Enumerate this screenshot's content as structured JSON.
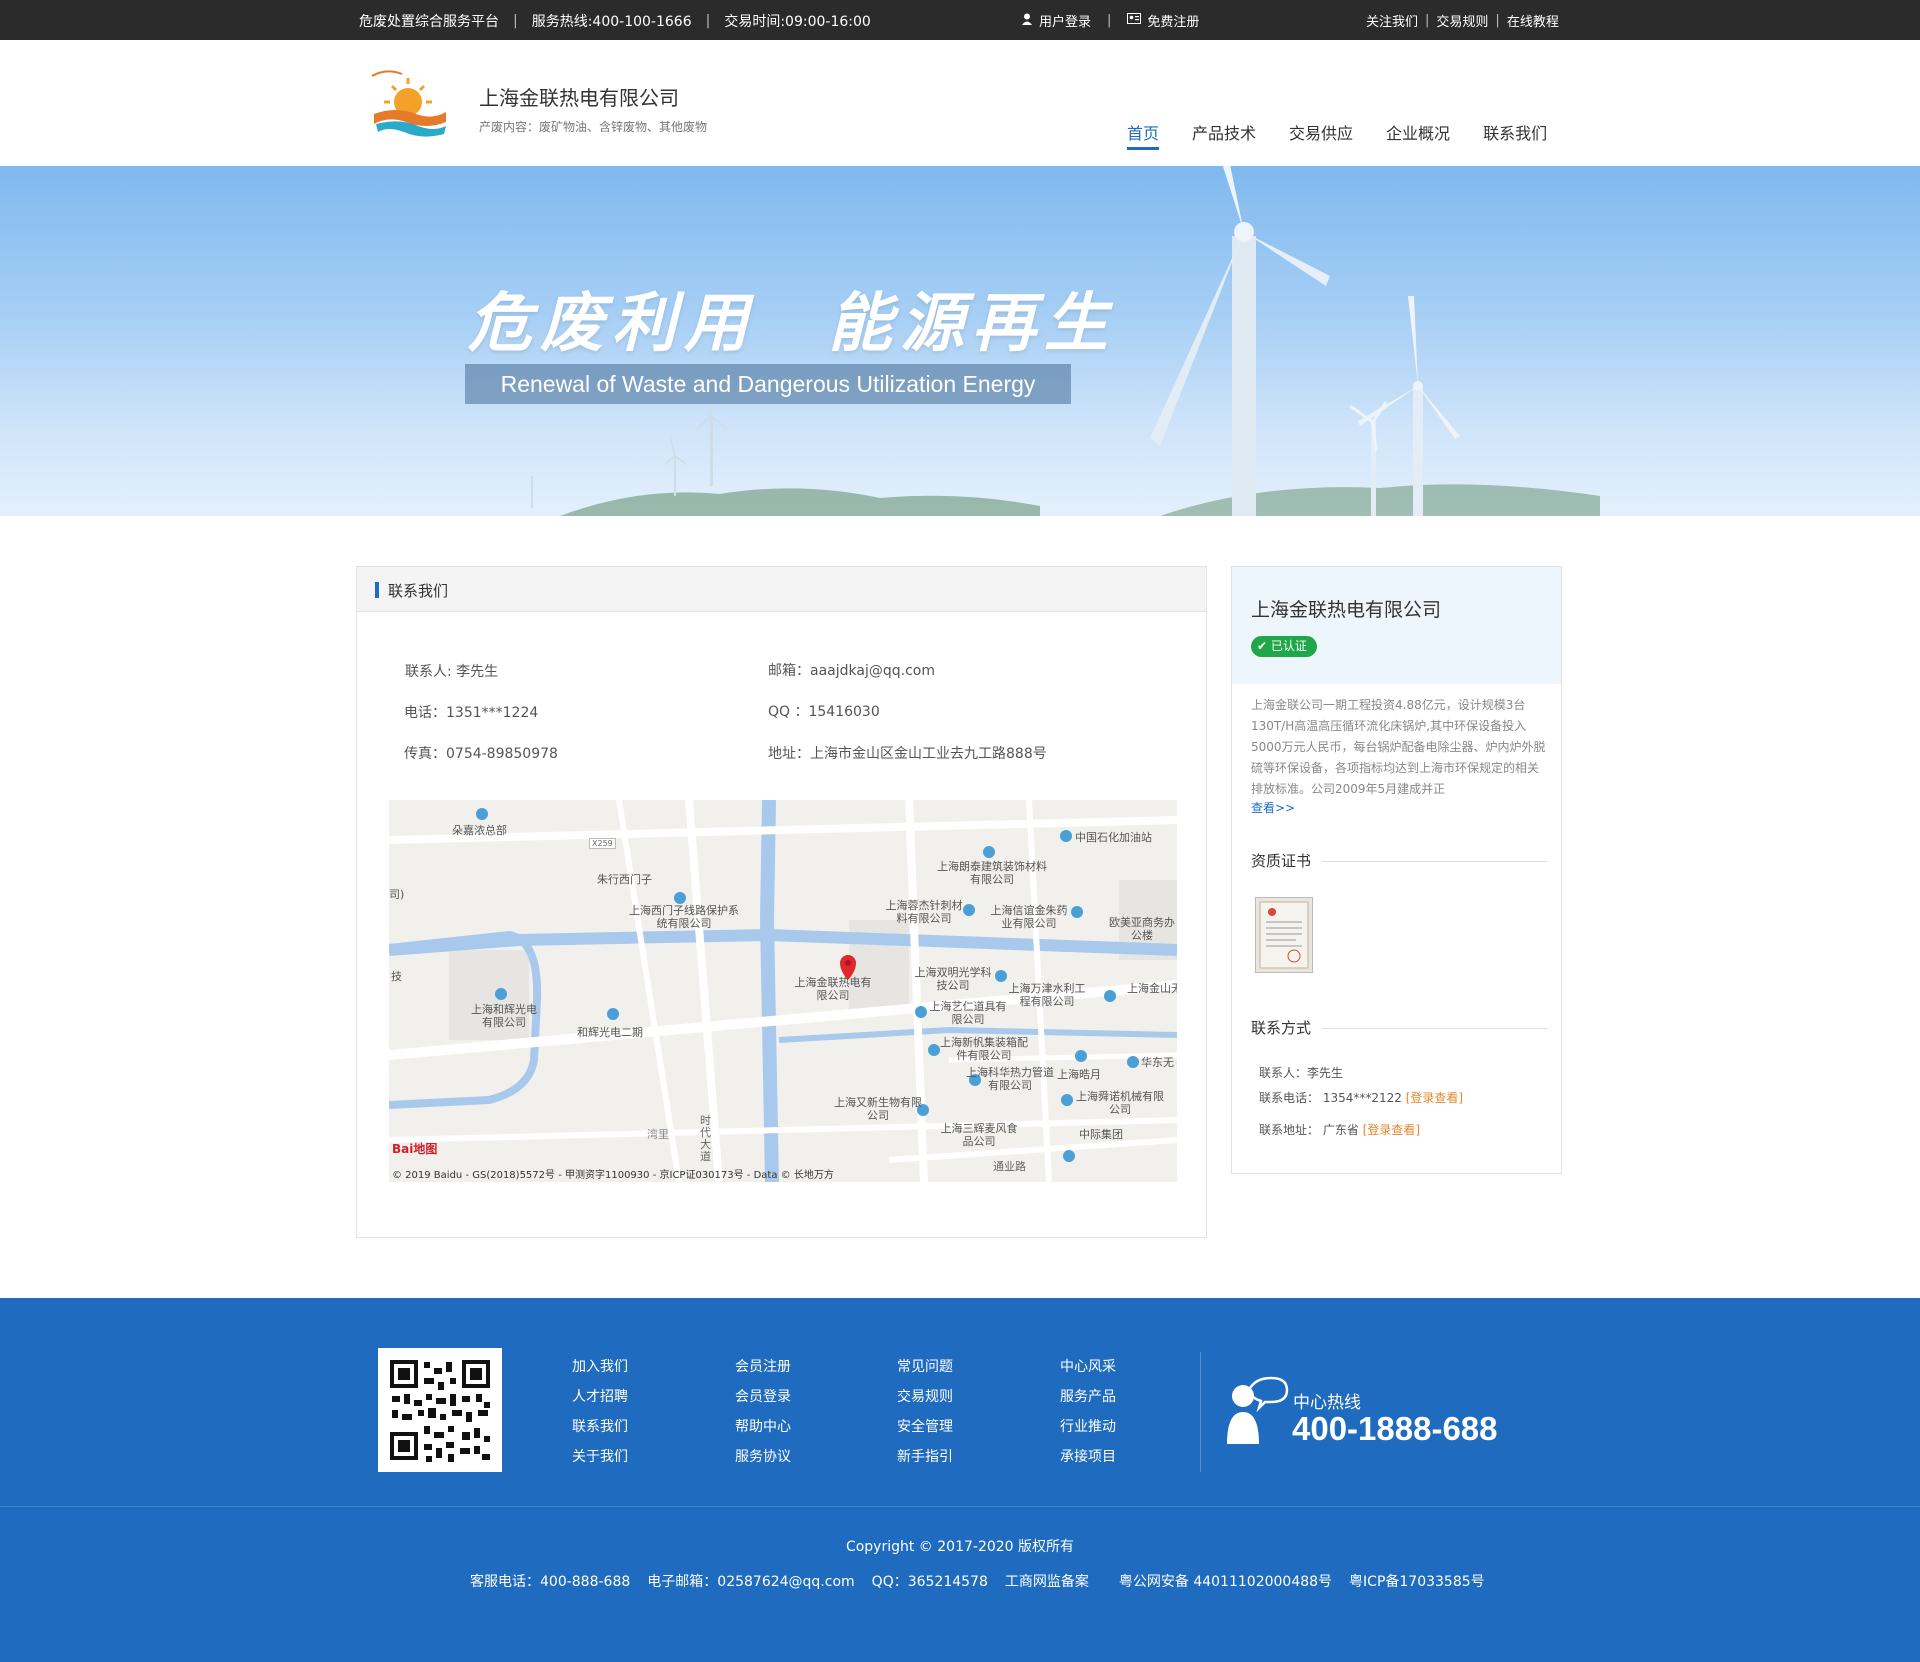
{
  "topbar": {
    "platform": "危废处置综合服务平台",
    "hotline": "服务热线:400-100-1666",
    "trade_time": "交易时间:09:00-16:00",
    "login": "用户登录",
    "register": "免费注册",
    "follow": "关注我们",
    "rules": "交易规则",
    "tutorial": "在线教程"
  },
  "header": {
    "company": "上海金联热电有限公司",
    "desc": "产废内容：废矿物油、含锌废物、其他废物",
    "nav": [
      "首页",
      "产品技术",
      "交易供应",
      "企业概况",
      "联系我们"
    ]
  },
  "banner": {
    "title": "危废利用　能源再生",
    "subtitle": "Renewal of Waste and Dangerous Utilization Energy"
  },
  "contact_panel": {
    "title": "联系我们",
    "contact": "联系人: 李先生",
    "email": "邮箱：aaajdkaj@qq.com",
    "phone": "电话：1351***1224",
    "qq": "QQ ：15416030",
    "fax": "传真：0754-89850978",
    "address": "地址：上海市金山区金山工业去九工路888号"
  },
  "map": {
    "labels": [
      "朵嘉浓总部",
      "中国石化加油站",
      "朱行西门子",
      "上海朗泰建筑装饰材料有限公司",
      "上海西门子线路保护系统有限公司",
      "上海蓉杰针刺材料有限公司",
      "上海信谊金朱药业有限公司",
      "欧美亚商务办公楼",
      "上海金联热电有限公司",
      "上海双明光学科技公司",
      "上海和辉光电有限公司",
      "上海万津水利工程有限公司",
      "上海金山无人飞行服务",
      "上海艺仁道具有限公司",
      "和辉光电二期",
      "上海新帆集装箱配件有限公司",
      "华东无",
      "上海科华热力管道有限公司",
      "上海晧月",
      "上海又新生物有限公司",
      "上海舜诺机械有限公司",
      "上海三辉麦风食品公司",
      "中际集团",
      "湾里",
      "时代大道",
      "通业路",
      "X259",
      "技",
      "司)"
    ],
    "copyright": "© 2019 Baidu - GS(2018)5572号 - 甲测资字1100930 - 京ICP证030173号 - Data © 长地万方",
    "brand": "Bai地图"
  },
  "side": {
    "company": "上海金联热电有限公司",
    "badge": "已认证",
    "desc": "上海金联公司一期工程投资4.88亿元，设计规模3台130T/H高温高压循环流化床锅炉,其中环保设备投入5000万元人民币，每台锅炉配备电除尘器、炉内炉外脱硫等环保设备，各项指标均达到上海市环保规定的相关排放标准。公司2009年5月建成并正",
    "more": "查看>>",
    "cert_title": "资质证书",
    "contact_title": "联系方式",
    "contact_person": "联系人：李先生",
    "contact_phone": "联系电话： 1354***2122",
    "contact_address": "联系地址： 广东省",
    "login_view": "[登录查看]"
  },
  "footer": {
    "col1": [
      "加入我们",
      "人才招聘",
      "联系我们",
      "关于我们"
    ],
    "col2": [
      "会员注册",
      "会员登录",
      "帮助中心",
      "服务协议"
    ],
    "col3": [
      "常见问题",
      "交易规则",
      "安全管理",
      "新手指引"
    ],
    "col4": [
      "中心风采",
      "服务产品",
      "行业推动",
      "承接项目"
    ],
    "hotline_label": "中心热线",
    "hotline": "400-1888-688",
    "copyright": "Copyright © 2017-2020  版权所有",
    "service_phone": "客服电话：400-888-688",
    "email": "电子邮箱：02587624@qq.com",
    "qq": "QQ：365214578",
    "icp_monitor": "工商网监备案",
    "police": "粤公网安备 44011102000488号",
    "icp": "粤ICP备17033585号"
  },
  "colors": {
    "primary": "#1e6bbf",
    "topbar": "#2b2b2b",
    "verified": "#1fa74a",
    "link_orange": "#e8862c"
  }
}
